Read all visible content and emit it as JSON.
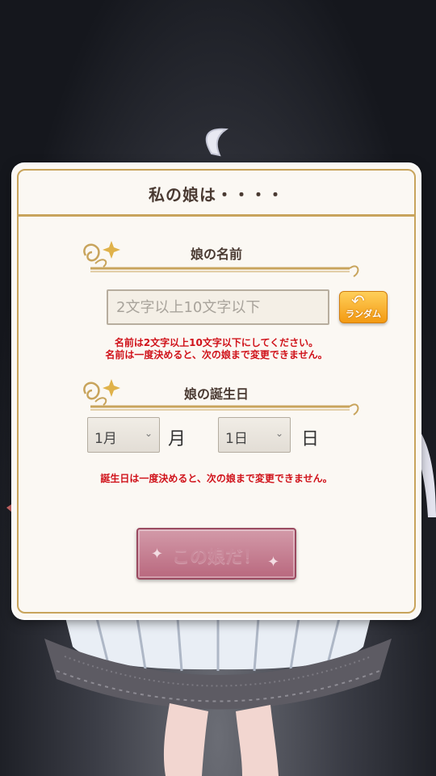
{
  "dialog": {
    "title": "私の娘は・・・・",
    "name_section": {
      "heading": "娘の名前",
      "input_placeholder": "2文字以上10文字以下",
      "input_value": "",
      "random_button_label": "ランダム",
      "notes": [
        "名前は2文字以上10文字以下にしてください。",
        "名前は一度決めると、次の娘まで変更できません。"
      ]
    },
    "birthday_section": {
      "heading": "娘の誕生日",
      "month_value": "1月",
      "month_unit": "月",
      "day_value": "1日",
      "day_unit": "日",
      "note": "誕生日は一度決めると、次の娘まで変更できません。"
    },
    "confirm_button_label": "この娘だ！"
  },
  "colors": {
    "accent_gold": "#c8a45c",
    "warning_red": "#d0121a",
    "random_orange": "#f39a12",
    "confirm_pink": "#b9687e"
  },
  "icons": {
    "ornament": "flourish-sparkle-icon",
    "random": "refresh-arrow-icon",
    "select": "chevron-down-icon"
  }
}
